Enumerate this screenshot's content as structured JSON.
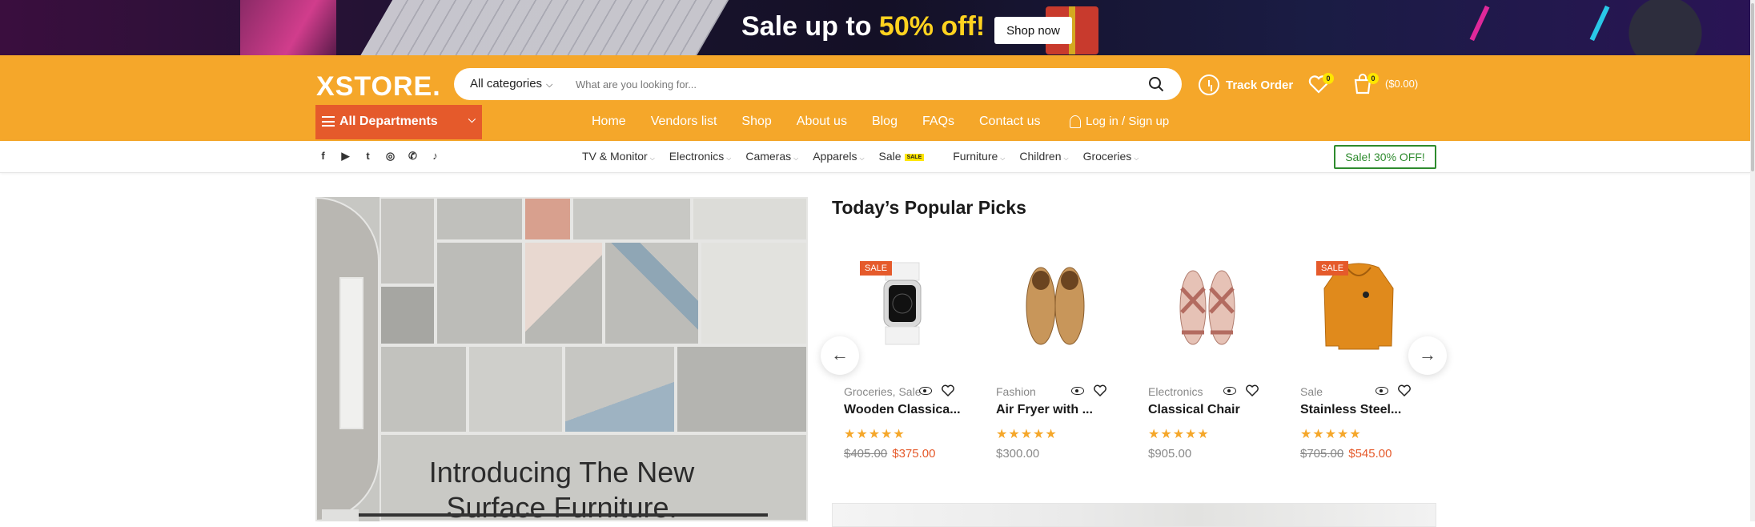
{
  "promo": {
    "text_pre": "Sale up to ",
    "text_hl": "50% off!",
    "button": "Shop now"
  },
  "logo": "XSTORE.",
  "search": {
    "category": "All categories",
    "placeholder": "What are you looking for..."
  },
  "header": {
    "track_order": "Track Order",
    "wishlist_count": "0",
    "cart_count": "0",
    "cart_total": "($0.00)"
  },
  "departments": "All Departments",
  "mainnav": [
    "Home",
    "Vendors list",
    "Shop",
    "About us",
    "Blog",
    "FAQs",
    "Contact us"
  ],
  "login": "Log in / Sign up",
  "socials": [
    "facebook-icon",
    "youtube-icon",
    "twitter-icon",
    "instagram-icon",
    "whatsapp-icon",
    "tiktok-icon"
  ],
  "catnav": [
    {
      "label": "TV & Monitor"
    },
    {
      "label": "Electronics"
    },
    {
      "label": "Cameras"
    },
    {
      "label": "Apparels"
    },
    {
      "label": "Sale",
      "badge": "SALE"
    },
    {
      "label": "Furniture"
    },
    {
      "label": "Children"
    },
    {
      "label": "Groceries"
    }
  ],
  "sale_badge": "Sale! 30% OFF!",
  "hero": {
    "line1": "Introducing The New",
    "line2": "Surface Furniture."
  },
  "popular": {
    "title": "Today’s Popular Picks",
    "products": [
      {
        "sale": "SALE",
        "category": "Groceries, Sale",
        "name": "Wooden Classica...",
        "old_price": "$405.00",
        "price": "$375.00",
        "rating": 5
      },
      {
        "sale": "",
        "category": "Fashion",
        "name": "Air Fryer with ...",
        "old_price": "",
        "price": "$300.00",
        "rating": 5
      },
      {
        "sale": "",
        "category": "Electronics",
        "name": "Classical Chair",
        "old_price": "",
        "price": "$905.00",
        "rating": 5
      },
      {
        "sale": "SALE",
        "category": "Sale",
        "name": "Stainless Steel...",
        "old_price": "$705.00",
        "price": "$545.00",
        "rating": 5
      }
    ]
  },
  "colors": {
    "header": "#f5a72a",
    "accent": "#e55a2b",
    "badge": "#ffe600",
    "sale_green": "#2e8b2e"
  }
}
